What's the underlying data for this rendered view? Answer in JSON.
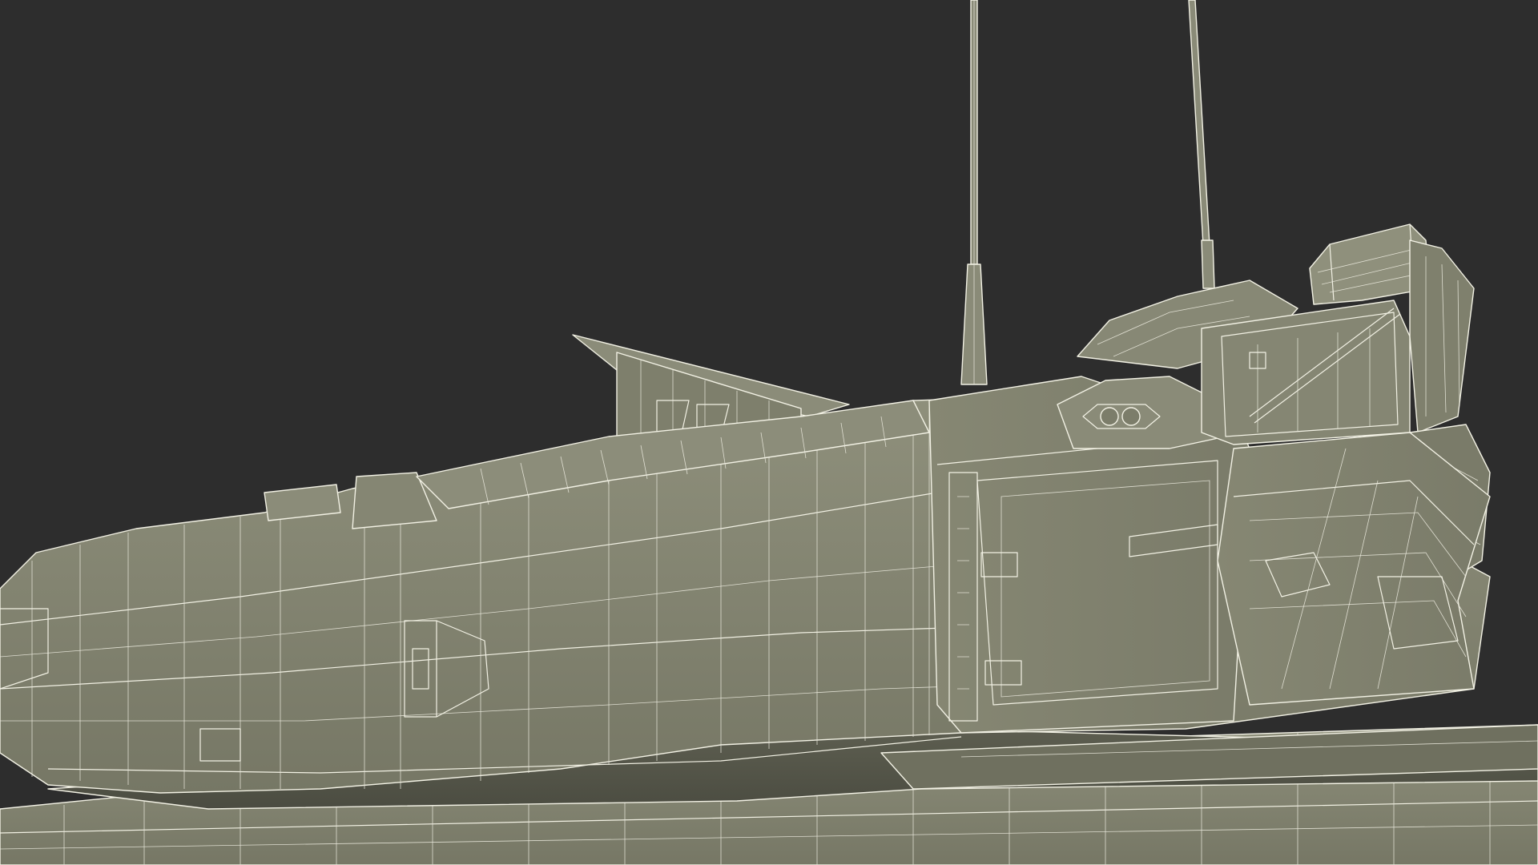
{
  "scene": {
    "subject": "tank-turret-wireframe-render",
    "colors": {
      "background": "#2d2d2d",
      "body_light": "#8e8e7b",
      "body_mid": "#7f806d",
      "body_dark": "#6a6b5b",
      "wire": "#f2f1e4"
    }
  }
}
